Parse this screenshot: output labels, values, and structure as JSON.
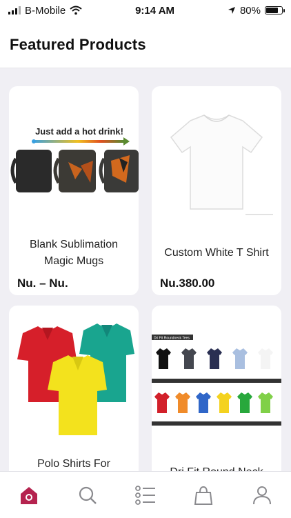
{
  "status_bar": {
    "carrier": "B-Mobile",
    "time": "9:14 AM",
    "battery_percent_text": "80%",
    "battery_level": 0.8
  },
  "header": {
    "title": "Featured Products"
  },
  "products": [
    {
      "title": "Blank Sublimation Magic Mugs",
      "price": "Nu. – Nu.",
      "image_text": "Just add a hot drink!"
    },
    {
      "title": "Custom White T Shirt",
      "price": "Nu.380.00"
    },
    {
      "title": "Polo Shirts For",
      "price": ""
    },
    {
      "title": "Dri Fit Round Neck",
      "price": "",
      "image_text": "Dri Fit Roundneck Tees"
    }
  ],
  "tabbar": {
    "items": [
      {
        "name": "home",
        "active": true
      },
      {
        "name": "search",
        "active": false
      },
      {
        "name": "categories",
        "active": false
      },
      {
        "name": "cart",
        "active": false
      },
      {
        "name": "account",
        "active": false
      }
    ]
  },
  "colors": {
    "accent": "#b5234f",
    "icon": "#8a8a8e",
    "background": "#f0eff4"
  }
}
